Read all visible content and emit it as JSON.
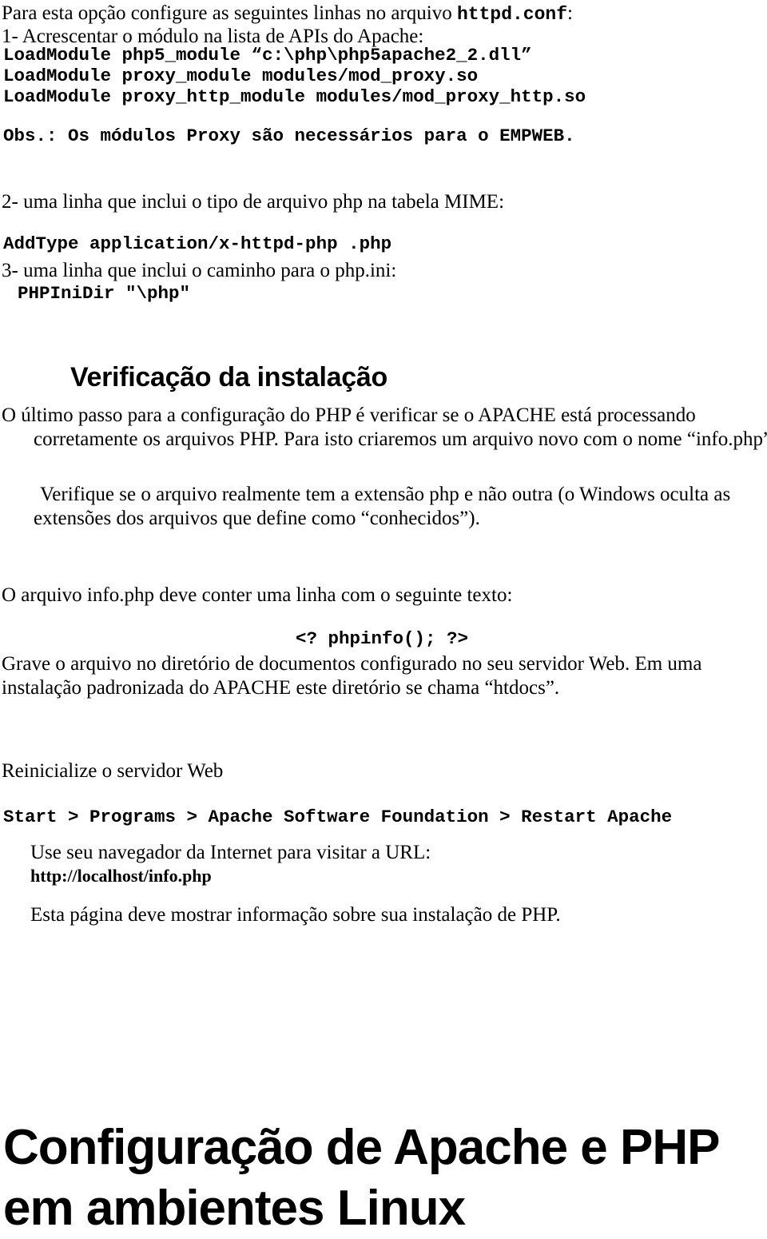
{
  "document": {
    "language": "pt-BR",
    "background_color": "#ffffff",
    "text_color": "#000000",
    "intro_line": "Para esta opção configure as seguintes linhas no arquivo ",
    "intro_code": "httpd.conf",
    "intro_suffix": ":",
    "step1": "1- Acrescentar o módulo na lista de APIs do Apache:",
    "loadmodules": "LoadModule php5_module “c:\\php\\php5apache2_2.dll”\nLoadModule proxy_module modules/mod_proxy.so\nLoadModule proxy_http_module modules/mod_proxy_http.so",
    "obs": "Obs.: Os módulos Proxy são necessários para o EMPWEB.",
    "step2": "2- uma linha que inclui o tipo de arquivo php na tabela MIME:",
    "addtype": "AddType application/x-httpd-php .php",
    "step3": "3- uma linha que inclui o caminho para o php.ini:",
    "phpinidir": "PHPIniDir \"\\php\"",
    "heading_verificacao": "Verificação da instalação",
    "para_ultimo": "O último passo para a configuração do PHP é verificar se o APACHE está processando corretamente os arquivos PHP. Para isto criaremos um arquivo novo com o nome “info.php”.",
    "para_verifique": "Verifique se o arquivo realmente tem a extensão php e não outra (o Windows oculta as extensões dos arquivos que define como “conhecidos”).",
    "line_oarquivo": "O arquivo info.php deve conter uma linha com o seguinte texto:",
    "code_phpinfo": "<? phpinfo(); ?>",
    "para_grave": "Grave o arquivo no diretório de documentos configurado no seu servidor Web. Em uma instalação padronizada do APACHE este diretório se chama “htdocs”.",
    "line_reinicialize": "Reinicialize o servidor Web",
    "code_start_menu": "Start > Programs > Apache Software Foundation > Restart Apache",
    "line_usenav": "Use seu navegador da Internet para visitar a URL:",
    "url": "http://localhost/info.php",
    "line_estapagina": "Esta página deve mostrar informação sobre sua instalação de PHP.",
    "heading_bottom": "Configuração de Apache e PHP em ambientes Linux"
  }
}
